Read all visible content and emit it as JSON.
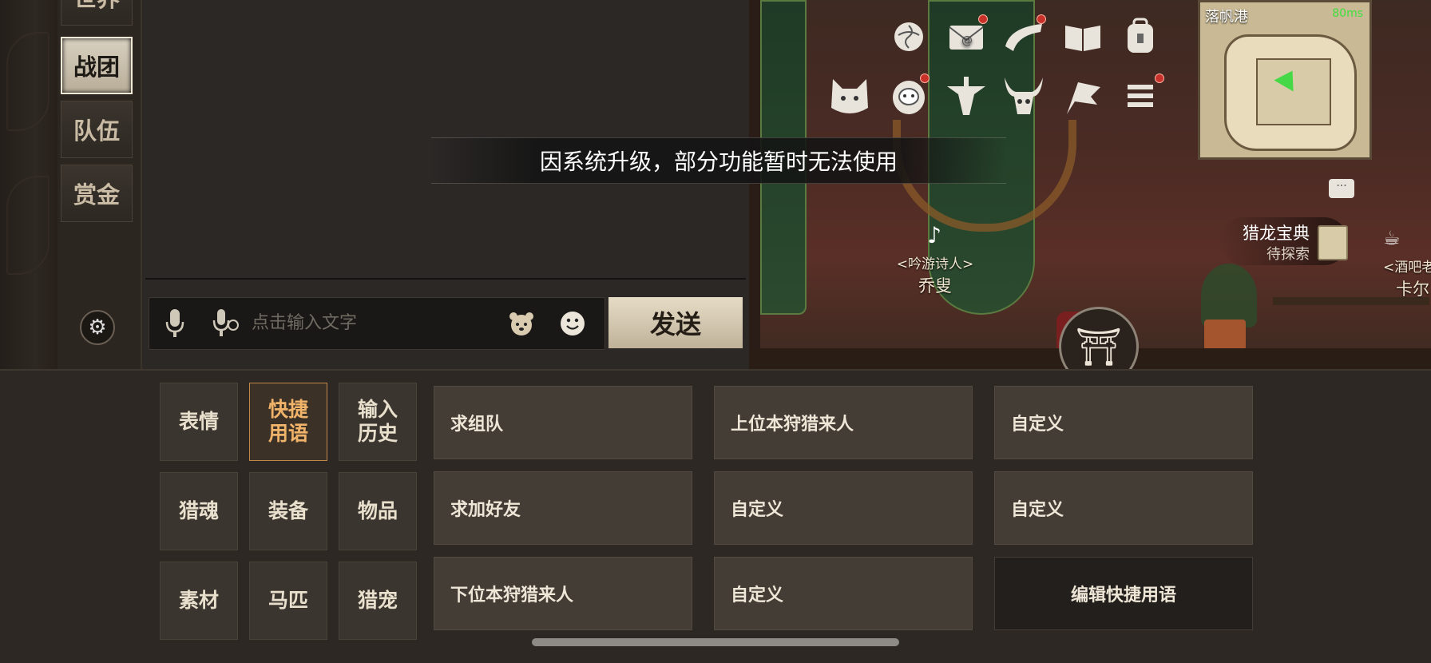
{
  "channels": {
    "tabs": [
      {
        "label": "世界"
      },
      {
        "label": "战团",
        "active": true
      },
      {
        "label": "队伍"
      },
      {
        "label": "赏金"
      }
    ],
    "settings_icon": "gear-icon"
  },
  "input": {
    "placeholder": "点击输入文字",
    "icons": [
      "microphone-icon",
      "voice-to-text-icon",
      "pet-sticker-icon",
      "emoji-icon"
    ],
    "send_label": "发送"
  },
  "notice": {
    "text": "因系统升级，部分功能暂时无法使用"
  },
  "minimap": {
    "location": "落帆港",
    "ping": "80ms"
  },
  "scene": {
    "npc1_title": "<吟游诗人>",
    "npc1_name": "乔叟",
    "npc2_title": "<酒吧老",
    "npc2_name": "卡尔",
    "codex_title": "猎龙宝典",
    "codex_subtitle": "待探索",
    "menu_icons": [
      "rose-icon",
      "mail-icon",
      "horn-icon",
      "book-icon",
      "backpack-icon",
      "cat-mask-icon",
      "daruma-icon",
      "crest-icon",
      "bull-skull-icon",
      "flag-icon",
      "list-menu-icon"
    ],
    "colors": {
      "red_dot": "#c8322a",
      "ping": "#3fe03f"
    }
  },
  "categories": [
    {
      "label": "表情"
    },
    {
      "label": "快捷\n用语",
      "active": true
    },
    {
      "label": "输入\n历史"
    },
    {
      "label": "猎魂"
    },
    {
      "label": "装备"
    },
    {
      "label": "物品"
    },
    {
      "label": "素材"
    },
    {
      "label": "马匹"
    },
    {
      "label": "猎宠"
    }
  ],
  "phrases": [
    {
      "label": "求组队"
    },
    {
      "label": "上位本狩猎来人"
    },
    {
      "label": "自定义"
    },
    {
      "label": "求加好友"
    },
    {
      "label": "自定义"
    },
    {
      "label": "自定义"
    },
    {
      "label": "下位本狩猎来人"
    },
    {
      "label": "自定义"
    },
    {
      "label": "编辑快捷用语"
    }
  ],
  "accent": {
    "active_category": "#f0b36a",
    "send_button": "#e6dcc6"
  }
}
